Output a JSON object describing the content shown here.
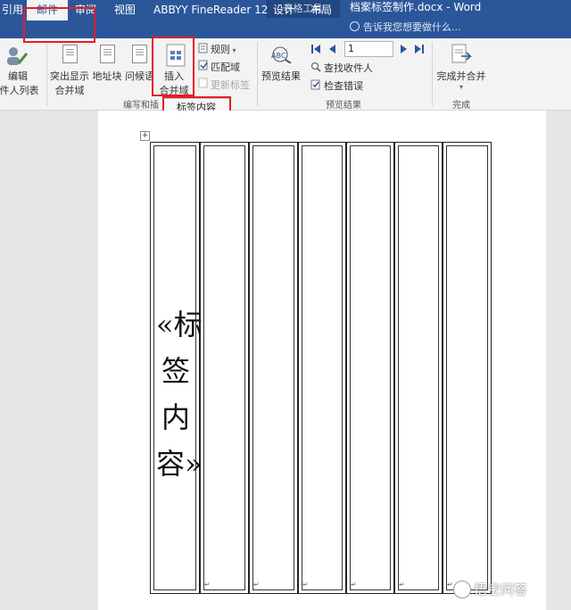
{
  "window": {
    "context_header": "表格工具",
    "document_title": "档案标签制作.docx - Word"
  },
  "tabs": [
    {
      "label": "引用",
      "active": false
    },
    {
      "label": "邮件",
      "active": true
    },
    {
      "label": "审阅",
      "active": false
    },
    {
      "label": "视图",
      "active": false
    },
    {
      "label": "ABBYY FineReader 12",
      "active": false
    },
    {
      "label": "设计",
      "active": false
    },
    {
      "label": "布局",
      "active": false
    }
  ],
  "tell_me": {
    "placeholder": "告诉我您想要做什么..."
  },
  "ribbon": {
    "edit_recipients": {
      "line1": "编辑",
      "line2": "收件人列表"
    },
    "highlight_fields": {
      "line1": "突出显示",
      "line2": "合并域"
    },
    "address_block": "地址块",
    "greeting_line": "问候语",
    "insert_merge_field": {
      "line1": "插入",
      "line2": "合并域"
    },
    "rules": "规则",
    "match_fields": "匹配域",
    "update_labels": "更新标签",
    "preview_results": "预览结果",
    "record_number": "1",
    "find_recipient": "查找收件人",
    "check_errors": "检查错误",
    "finish_merge": "完成并合并",
    "groups": {
      "write_insert": "编写和插",
      "preview": "预览结果",
      "finish": "完成"
    }
  },
  "dropdown": {
    "item": "标签内容"
  },
  "document": {
    "merge_field_text": "«标签内容»",
    "column_count": 7
  },
  "watermark": "悟空问答",
  "colors": {
    "accent": "#2b579a",
    "highlight_box": "#e21f26"
  }
}
